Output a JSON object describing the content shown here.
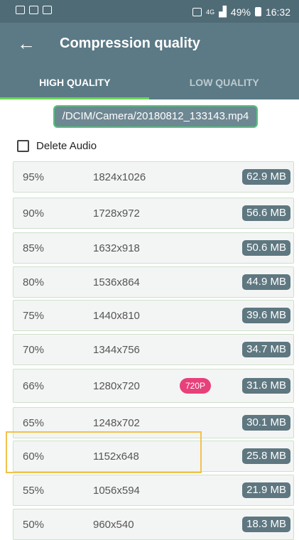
{
  "status_bar": {
    "network": "4G",
    "battery": "49%",
    "time": "16:32"
  },
  "toolbar": {
    "title": "Compression quality"
  },
  "tabs": [
    {
      "label": "HIGH QUALITY",
      "active": true
    },
    {
      "label": "LOW QUALITY",
      "active": false
    }
  ],
  "file_path": "/DCIM/Camera/20180812_133143.mp4",
  "delete_audio": {
    "label": "Delete Audio",
    "checked": false
  },
  "options": [
    {
      "percent": "95%",
      "resolution": "1824x1026",
      "size": "62.9 MB",
      "badge": ""
    },
    {
      "percent": "90%",
      "resolution": "1728x972",
      "size": "56.6 MB",
      "badge": ""
    },
    {
      "percent": "85%",
      "resolution": "1632x918",
      "size": "50.6 MB",
      "badge": ""
    },
    {
      "percent": "80%",
      "resolution": "1536x864",
      "size": "44.9 MB",
      "badge": ""
    },
    {
      "percent": "75%",
      "resolution": "1440x810",
      "size": "39.6 MB",
      "badge": ""
    },
    {
      "percent": "70%",
      "resolution": "1344x756",
      "size": "34.7 MB",
      "badge": ""
    },
    {
      "percent": "66%",
      "resolution": "1280x720",
      "size": "31.6 MB",
      "badge": "720P"
    },
    {
      "percent": "65%",
      "resolution": "1248x702",
      "size": "30.1 MB",
      "badge": ""
    },
    {
      "percent": "60%",
      "resolution": "1152x648",
      "size": "25.8 MB",
      "badge": ""
    },
    {
      "percent": "55%",
      "resolution": "1056x594",
      "size": "21.9 MB",
      "badge": ""
    },
    {
      "percent": "50%",
      "resolution": "960x540",
      "size": "18.3 MB",
      "badge": ""
    }
  ],
  "colors": {
    "toolbar": "#5b7a86",
    "status_bar": "#4f6b76",
    "tab_indicator": "#6dd45a",
    "badge": "#e8407a",
    "highlight": "#f2c14b"
  }
}
